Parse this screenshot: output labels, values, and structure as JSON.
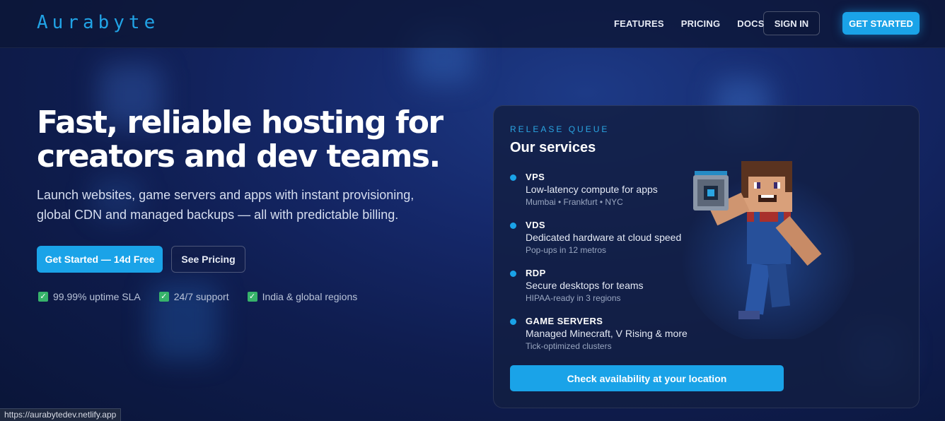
{
  "brand": {
    "logo": "Aurabyte",
    "accent": "#1aa3e8"
  },
  "nav": {
    "items": [
      {
        "label": "FEATURES"
      },
      {
        "label": "PRICING"
      },
      {
        "label": "DOCS"
      }
    ],
    "signin_label": "SIGN IN",
    "getstarted_label": "GET STARTED"
  },
  "hero": {
    "title": "Fast, reliable hosting for creators and dev teams.",
    "subtitle": "Launch websites, game servers and apps with instant provisioning, global CDN and managed backups — all with predictable billing.",
    "primary_cta": "Get Started — 14d Free",
    "secondary_cta": "See Pricing",
    "features": [
      {
        "icon": "checkmark-icon",
        "label": "99.99% uptime SLA"
      },
      {
        "icon": "checkmark-icon",
        "label": "24/7 support"
      },
      {
        "icon": "checkmark-icon",
        "label": "India & global regions"
      }
    ]
  },
  "card": {
    "eyebrow": "RELEASE QUEUE",
    "title": "Our services",
    "services": [
      {
        "name": "VPS",
        "desc": "Low-latency compute for apps",
        "meta": "Mumbai • Frankfurt • NYC"
      },
      {
        "name": "VDS",
        "desc": "Dedicated hardware at cloud speed",
        "meta": "Pop-ups in 12 metros"
      },
      {
        "name": "RDP",
        "desc": "Secure desktops for teams",
        "meta": "HIPAA-ready in 3 regions"
      },
      {
        "name": "GAME SERVERS",
        "desc": "Managed Minecraft, V Rising & more",
        "meta": "Tick-optimized clusters"
      }
    ],
    "cta": "Check availability at your location"
  },
  "statusbar": {
    "url": "https://aurabytedev.netlify.app"
  }
}
